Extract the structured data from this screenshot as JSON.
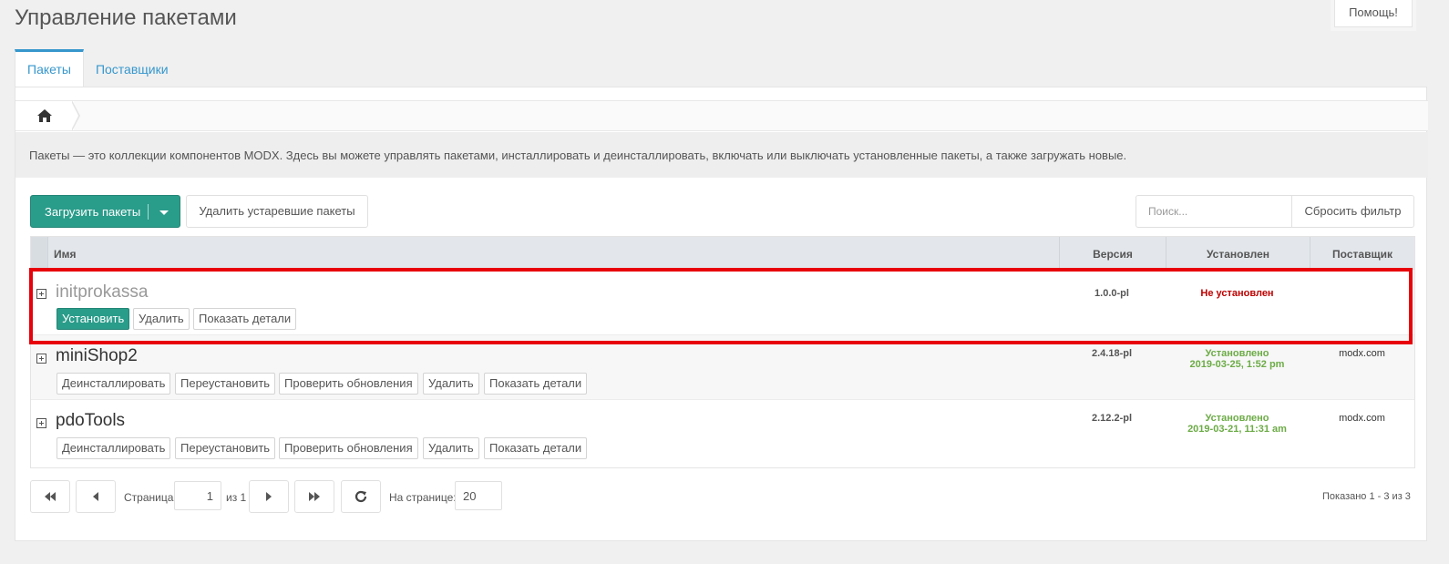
{
  "page": {
    "title": "Управление пакетами",
    "help_label": "Помощь!"
  },
  "tabs": [
    {
      "label": "Пакеты",
      "active": true
    },
    {
      "label": "Поставщики",
      "active": false
    }
  ],
  "breadcrumb": {
    "home_icon": "home-icon"
  },
  "intro_text": "Пакеты — это коллекции компонентов MODX. Здесь вы можете управлять пакетами, инсталлировать и деинсталлировать, включать или выключать установленные пакеты, а также загружать новые.",
  "toolbar": {
    "download_label": "Загрузить пакеты",
    "remove_outdated_label": "Удалить устаревшие пакеты",
    "search_placeholder": "Поиск...",
    "reset_filter_label": "Сбросить фильтр"
  },
  "grid": {
    "columns": [
      "Имя",
      "Версия",
      "Установлен",
      "Поставщик"
    ],
    "rows": [
      {
        "name": "initprokassa",
        "version": "1.0.0-pl",
        "installed_line1": "Не установлен",
        "installed_line2": "",
        "provider": "",
        "actions": [
          "Установить",
          "Удалить",
          "Показать детали"
        ]
      },
      {
        "name": "miniShop2",
        "version": "2.4.18-pl",
        "installed_line1": "Установлено",
        "installed_line2": "2019-03-25, 1:52 pm",
        "provider": "modx.com",
        "actions": [
          "Деинсталлировать",
          "Переустановить",
          "Проверить обновления",
          "Удалить",
          "Показать детали"
        ]
      },
      {
        "name": "pdoTools",
        "version": "2.12.2-pl",
        "installed_line1": "Установлено",
        "installed_line2": "2019-03-21, 11:31 am",
        "provider": "modx.com",
        "actions": [
          "Деинсталлировать",
          "Переустановить",
          "Проверить обновления",
          "Удалить",
          "Показать детали"
        ]
      }
    ]
  },
  "pager": {
    "page_label": "Страница",
    "page_value": "1",
    "of_label": "из 1",
    "per_page_label": "На странице:",
    "per_page_value": "20",
    "summary": "Показано 1 - 3 из 3"
  },
  "colors": {
    "accent": "#2a9c8a",
    "link": "#3697cd",
    "not_installed": "#be0000",
    "installed": "#6cab46",
    "highlight": "#e8000b"
  }
}
